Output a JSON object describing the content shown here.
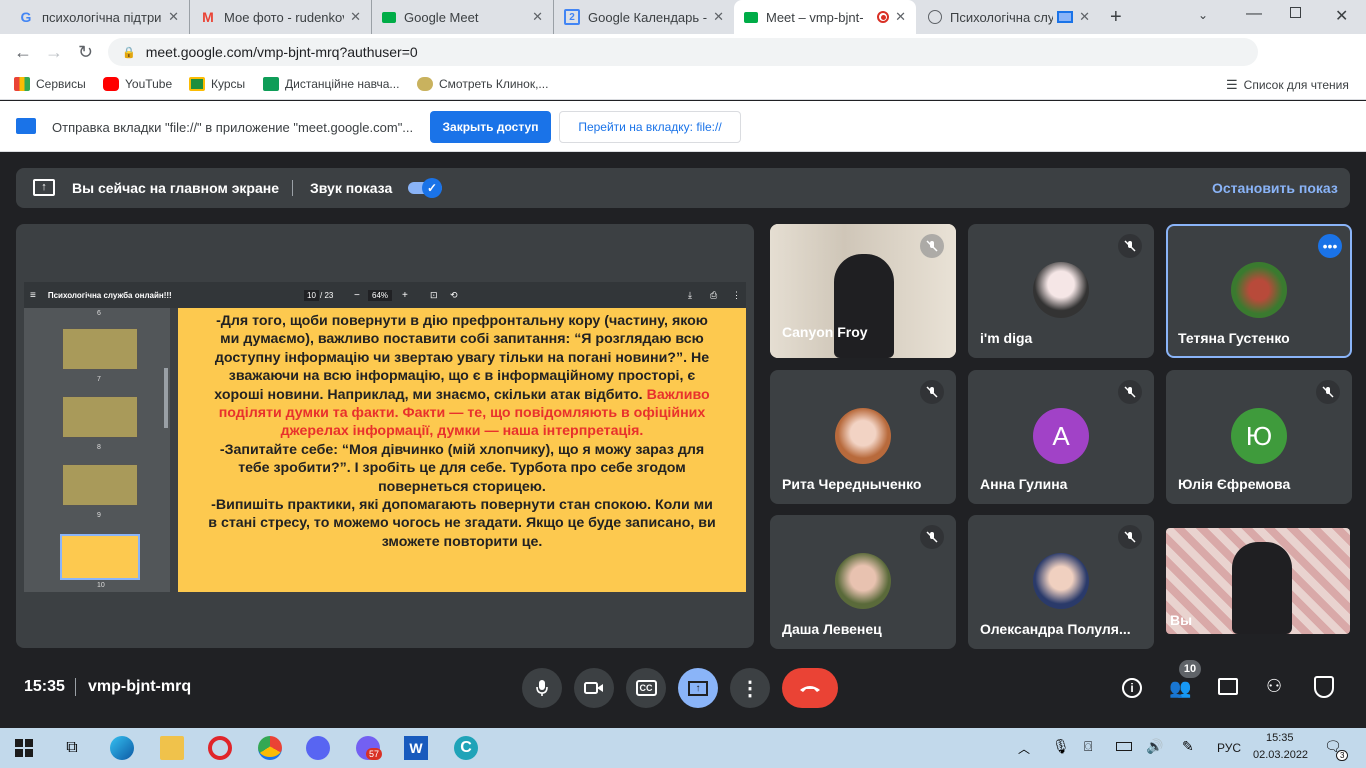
{
  "browser": {
    "tabs": [
      {
        "title": "психологічна підтрим",
        "icon": "google-icon"
      },
      {
        "title": "Мое фото - rudenkov",
        "icon": "gmail-icon"
      },
      {
        "title": "Google Meet",
        "icon": "meet-icon"
      },
      {
        "title": "Google Календарь - с",
        "icon": "calendar-icon",
        "badge": "2"
      },
      {
        "title": "Meet – vmp-bjnt-",
        "icon": "meet-icon",
        "active": true
      },
      {
        "title": "Психологічна слу",
        "icon": "globe-icon"
      }
    ],
    "url": "meet.google.com/vmp-bjnt-mrq?authuser=0",
    "bookmarks": [
      {
        "label": "Сервисы"
      },
      {
        "label": "YouTube"
      },
      {
        "label": "Курсы"
      },
      {
        "label": "Дистанційне навча..."
      },
      {
        "label": "Смотреть Клинок,..."
      }
    ],
    "reading_list": "Список для чтения",
    "infobar": {
      "message": "Отправка вкладки \"file://\" в приложение \"meet.google.com\"...",
      "share_button": "Закрыть доступ",
      "switch_button": "Перейти на вкладку: file://"
    }
  },
  "meet": {
    "presenting_text": "Вы сейчас на главном экране",
    "sound_label": "Звук показа",
    "sound_enabled": true,
    "stop_label": "Остановить показ",
    "pdf": {
      "title": "Психологічна служба онлайн!!!",
      "page": "10",
      "pages": "/ 23",
      "zoom": "64%",
      "thumb_numbers": [
        "6",
        "7",
        "8",
        "9",
        "10"
      ],
      "paragraph1": "-Для того, щоби повернути в дію префронтальну кору (частину, якою ми думаємо), важливо поставити собі запитання: “Я розглядаю всю доступну інформацію чи звертаю увагу тільки на погані новини?”. Не зважаючи на всю інформацію, що є в інформаційному просторі, є хороші новини. Наприклад, ми знаємо, скільки атак відбито. ",
      "paragraph1_red": "Важливо поділяти думки та факти. Факти — те, що повідомляють в офіційних джерелах інформації, думки — наша інтерпретація.",
      "paragraph2": "-Запитайте себе: “Моя дівчинко (мій хлопчику), що я можу зараз для тебе зробити?”. І зробіть це для себе. Турбота про себе згодом повернеться сторицею.",
      "paragraph3": "-Випишіть практики, які допомагають повернути стан спокою. Коли ми в стані стресу, то можемо чогось не згадати. Якщо це буде записано, ви зможете повторити це."
    },
    "participants": [
      {
        "name": "Canyon Froy",
        "type": "video",
        "muted": true
      },
      {
        "name": "i'm diga",
        "type": "photo",
        "muted": true
      },
      {
        "name": "Тетяна Густенко",
        "type": "photo",
        "muted": false,
        "active": true
      },
      {
        "name": "Рита Чередныченко",
        "type": "photo",
        "muted": true
      },
      {
        "name": "Анна Гулина",
        "type": "letter",
        "letter": "А",
        "color": "#a142c7",
        "muted": true
      },
      {
        "name": "Юлія Єфремова",
        "type": "letter",
        "letter": "Ю",
        "color": "#3f9b3c",
        "muted": true
      },
      {
        "name": "Даша Левенец",
        "type": "photo",
        "muted": true
      },
      {
        "name": "Олександра Полуля...",
        "type": "photo",
        "muted": true
      },
      {
        "name": "Вы",
        "type": "video",
        "muted": false
      }
    ],
    "time": "15:35",
    "meeting_code": "vmp-bjnt-mrq",
    "participant_count": "10"
  },
  "taskbar": {
    "language": "РУС",
    "clock_time": "15:35",
    "clock_date": "02.03.2022",
    "viber_badge": "57",
    "notif_badge": "3"
  },
  "colors": {
    "meet_bg": "#202124",
    "tile_bg": "#3c4043",
    "accent": "#8ab4f8",
    "hangup": "#ea4335",
    "pdf_page": "#fdc94f"
  }
}
